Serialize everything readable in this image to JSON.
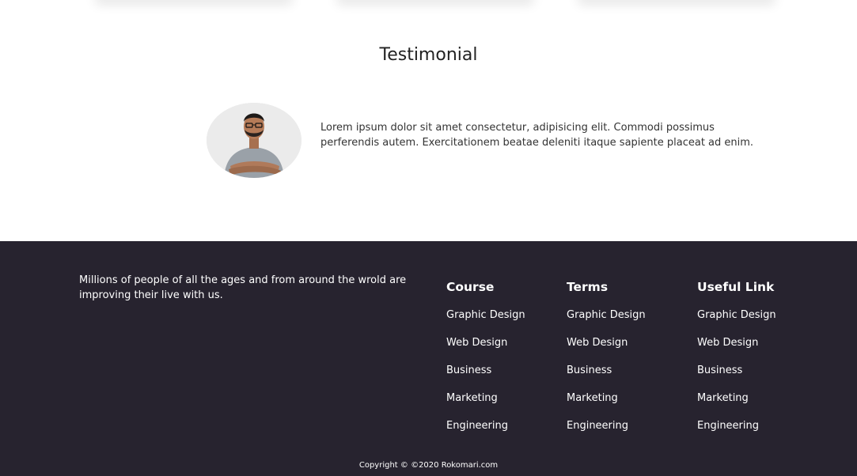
{
  "testimonial": {
    "title": "Testimonial",
    "quote": "Lorem ipsum dolor sit amet consectetur, adipisicing elit. Commodi possimus perferendis autem. Exercitationem beatae deleniti itaque sapiente placeat ad enim."
  },
  "footer": {
    "about": "Millions of people of all the ages and from around the wrold are improving their live with us.",
    "columns": [
      {
        "heading": "Course",
        "links": [
          "Graphic Design",
          "Web Design",
          "Business",
          "Marketing",
          "Engineering"
        ]
      },
      {
        "heading": "Terms",
        "links": [
          "Graphic Design",
          "Web Design",
          "Business",
          "Marketing",
          "Engineering"
        ]
      },
      {
        "heading": "Useful Link",
        "links": [
          "Graphic Design",
          "Web Design",
          "Business",
          "Marketing",
          "Engineering"
        ]
      }
    ],
    "copyright": "Copyright © ©2020 Rokomari.com"
  },
  "colors": {
    "footer_bg": "#27232f",
    "text_dark": "#222222",
    "text_light": "#ffffff"
  }
}
